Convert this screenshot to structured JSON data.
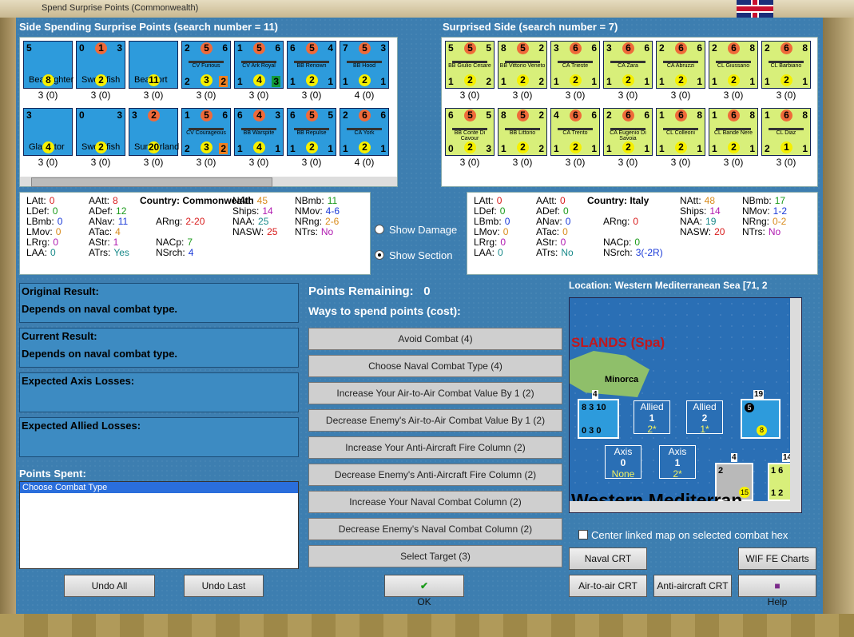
{
  "window_title": "Spend Surprise Points (Commonwealth)",
  "left_header": "Side Spending Surprise Points (search number = 11)",
  "right_header": "Surprised Side (search number = 7)",
  "left_units": [
    {
      "tl": "5",
      "tm": "",
      "tr": "",
      "name": "Beaufighter",
      "bl": "",
      "bm": "8",
      "br": "",
      "cap": "3 (0)",
      "kind": "plane"
    },
    {
      "tl": "0",
      "tm": "1",
      "tr": "3",
      "name": "Swordfish",
      "bl": "",
      "bm": "2",
      "br": "",
      "cap": "3 (0)",
      "kind": "plane"
    },
    {
      "tl": "",
      "tm": "",
      "tr": "",
      "name": "Beaufort",
      "bl": "",
      "bm": "11",
      "br": "",
      "cap": "3 (0)",
      "kind": "plane"
    },
    {
      "tl": "2",
      "tm": "5",
      "tr": "6",
      "name": "CV Furious",
      "bl": "2",
      "bm": "3",
      "br": "2",
      "cap": "3 (0)",
      "kind": "ship",
      "brbox": "orange"
    },
    {
      "tl": "1",
      "tm": "5",
      "tr": "6",
      "name": "CV Ark Royal",
      "bl": "1",
      "bm": "4",
      "br": "3",
      "cap": "3 (0)",
      "kind": "ship",
      "brbox": "green"
    },
    {
      "tl": "6",
      "tm": "5",
      "tr": "4",
      "name": "BB Renown",
      "bl": "1",
      "bm": "2",
      "br": "1",
      "cap": "3 (0)",
      "kind": "ship"
    },
    {
      "tl": "7",
      "tm": "5",
      "tr": "3",
      "name": "BB Hood",
      "bl": "1",
      "bm": "2",
      "br": "1",
      "cap": "4 (0)",
      "kind": "ship"
    },
    {
      "tl": "3",
      "tm": "",
      "tr": "",
      "name": "Gladiator",
      "bl": "",
      "bm": "4",
      "br": "",
      "cap": "3 (0)",
      "kind": "plane"
    },
    {
      "tl": "0",
      "tm": "",
      "tr": "3",
      "name": "Swordfish",
      "bl": "",
      "bm": "2",
      "br": "",
      "cap": "3 (0)",
      "kind": "plane"
    },
    {
      "tl": "3",
      "tm": "2",
      "tr": "",
      "name": "Sunderland",
      "bl": "",
      "bm": "20",
      "br": "",
      "cap": "3 (0)",
      "kind": "plane"
    },
    {
      "tl": "1",
      "tm": "5",
      "tr": "6",
      "name": "CV Courageous",
      "bl": "2",
      "bm": "3",
      "br": "2",
      "cap": "3 (0)",
      "kind": "ship",
      "brbox": "orange"
    },
    {
      "tl": "6",
      "tm": "4",
      "tr": "3",
      "name": "BB Warspite",
      "bl": "1",
      "bm": "4",
      "br": "1",
      "cap": "3 (0)",
      "kind": "ship"
    },
    {
      "tl": "6",
      "tm": "5",
      "tr": "5",
      "name": "BB Repulse",
      "bl": "1",
      "bm": "2",
      "br": "1",
      "cap": "3 (0)",
      "kind": "ship"
    },
    {
      "tl": "2",
      "tm": "6",
      "tr": "6",
      "name": "CA York",
      "bl": "1",
      "bm": "2",
      "br": "1",
      "cap": "4 (0)",
      "kind": "ship"
    }
  ],
  "right_units": [
    {
      "tl": "5",
      "tm": "5",
      "tr": "5",
      "name": "BB Giulio Cesare",
      "bl": "1",
      "bm": "2",
      "br": "2",
      "cap": "3 (0)"
    },
    {
      "tl": "8",
      "tm": "5",
      "tr": "2",
      "name": "BB Vittorio Veneto",
      "bl": "1",
      "bm": "2",
      "br": "2",
      "cap": "3 (0)"
    },
    {
      "tl": "3",
      "tm": "6",
      "tr": "6",
      "name": "CA Trieste",
      "bl": "1",
      "bm": "2",
      "br": "1",
      "cap": "3 (0)"
    },
    {
      "tl": "3",
      "tm": "6",
      "tr": "6",
      "name": "CA Zara",
      "bl": "1",
      "bm": "2",
      "br": "1",
      "cap": "3 (0)"
    },
    {
      "tl": "2",
      "tm": "6",
      "tr": "6",
      "name": "CA Abruzzi",
      "bl": "1",
      "bm": "2",
      "br": "1",
      "cap": "3 (0)"
    },
    {
      "tl": "2",
      "tm": "6",
      "tr": "8",
      "name": "CL Giussano",
      "bl": "1",
      "bm": "2",
      "br": "1",
      "cap": "3 (0)"
    },
    {
      "tl": "2",
      "tm": "6",
      "tr": "8",
      "name": "CL Barbiano",
      "bl": "1",
      "bm": "2",
      "br": "1",
      "cap": "3 (0)"
    },
    {
      "tl": "6",
      "tm": "5",
      "tr": "5",
      "name": "BB Conte Di Cavour",
      "bl": "0",
      "bm": "2",
      "br": "3",
      "cap": "3 (0)"
    },
    {
      "tl": "8",
      "tm": "5",
      "tr": "2",
      "name": "BB Littorio",
      "bl": "1",
      "bm": "2",
      "br": "2",
      "cap": "3 (0)"
    },
    {
      "tl": "4",
      "tm": "6",
      "tr": "6",
      "name": "CA Trento",
      "bl": "1",
      "bm": "2",
      "br": "1",
      "cap": "3 (0)"
    },
    {
      "tl": "2",
      "tm": "6",
      "tr": "6",
      "name": "CA Eugenio Di Savoia",
      "bl": "1",
      "bm": "2",
      "br": "1",
      "cap": "3 (0)"
    },
    {
      "tl": "1",
      "tm": "6",
      "tr": "8",
      "name": "CL Colleoni",
      "bl": "1",
      "bm": "2",
      "br": "1",
      "cap": "3 (0)"
    },
    {
      "tl": "1",
      "tm": "6",
      "tr": "8",
      "name": "CL Bande Nere",
      "bl": "1",
      "bm": "2",
      "br": "1",
      "cap": "3 (0)"
    },
    {
      "tl": "1",
      "tm": "6",
      "tr": "8",
      "name": "CL Diaz",
      "bl": "2",
      "bm": "1",
      "br": "1",
      "cap": "3 (0)"
    }
  ],
  "left_stats": {
    "country_label": "Country: Commonwealth",
    "lines": [
      [
        "LAtt:",
        "0"
      ],
      [
        "LDef:",
        "0"
      ],
      [
        "LBmb:",
        "0"
      ],
      [
        "LMov:",
        "0"
      ],
      [
        "LRrg:",
        "0"
      ],
      [
        "LAA:",
        "0"
      ],
      [
        "AAtt:",
        "8"
      ],
      [
        "ADef:",
        "12"
      ],
      [
        "ANav:",
        "11"
      ],
      [
        "ATac:",
        "4"
      ],
      [
        "AStr:",
        "1"
      ],
      [
        "ATrs:",
        "Yes"
      ],
      [
        "ARng:",
        "2-20"
      ],
      [
        "NACp:",
        "7"
      ],
      [
        "NSrch:",
        "4"
      ],
      [
        "NAtt:",
        "45"
      ],
      [
        "Ships:",
        "14"
      ],
      [
        "NAA:",
        "25"
      ],
      [
        "NASW:",
        "25"
      ],
      [
        "NBmb:",
        "11"
      ],
      [
        "NMov:",
        "4-6"
      ],
      [
        "NRng:",
        "2-6"
      ],
      [
        "NTrs:",
        "No"
      ]
    ]
  },
  "right_stats": {
    "country_label": "Country: Italy",
    "lines": [
      [
        "LAtt:",
        "0"
      ],
      [
        "LDef:",
        "0"
      ],
      [
        "LBmb:",
        "0"
      ],
      [
        "LMov:",
        "0"
      ],
      [
        "LRrg:",
        "0"
      ],
      [
        "LAA:",
        "0"
      ],
      [
        "AAtt:",
        "0"
      ],
      [
        "ADef:",
        "0"
      ],
      [
        "ANav:",
        "0"
      ],
      [
        "ATac:",
        "0"
      ],
      [
        "AStr:",
        "0"
      ],
      [
        "ATrs:",
        "No"
      ],
      [
        "ARng:",
        "0"
      ],
      [
        "NACp:",
        "0"
      ],
      [
        "NSrch:",
        "3(-2R)"
      ],
      [
        "NAtt:",
        "48"
      ],
      [
        "Ships:",
        "14"
      ],
      [
        "NAA:",
        "19"
      ],
      [
        "NASW:",
        "20"
      ],
      [
        "NBmb:",
        "17"
      ],
      [
        "NMov:",
        "1-2"
      ],
      [
        "NRng:",
        "0-2"
      ],
      [
        "NTrs:",
        "No"
      ]
    ]
  },
  "radios": {
    "show_damage": "Show Damage",
    "show_section": "Show Section"
  },
  "results": [
    {
      "label": "Original Result:",
      "value": "Depends on naval combat type."
    },
    {
      "label": "Current Result:",
      "value": "Depends on naval combat type."
    },
    {
      "label": "Expected Axis Losses:",
      "value": ""
    },
    {
      "label": "Expected Allied Losses:",
      "value": ""
    }
  ],
  "points_spent_label": "Points Spent:",
  "points_spent_items": [
    "Choose Combat Type"
  ],
  "points_remaining_label": "Points Remaining:",
  "points_remaining_value": "0",
  "ways_label": "Ways to spend points (cost):",
  "ways": [
    "Avoid Combat (4)",
    "Choose Naval Combat Type (4)",
    "Increase Your Air-to-Air Combat Value By 1 (2)",
    "Decrease Enemy's Air-to-Air Combat Value By 1 (2)",
    "Increase Your Anti-Aircraft Fire Column (2)",
    "Decrease Enemy's Anti-Aircraft Fire Column (2)",
    "Increase Your Naval Combat Column (2)",
    "Decrease Enemy's Naval Combat Column (2)",
    "Select Target (3)"
  ],
  "location_label": "Location: Western Mediterranean Sea [71, 2",
  "map": {
    "islands_label": "SLANDS (Spa)",
    "minorca_label": "Minorca",
    "sea_label": "Western Mediterran",
    "allied1": {
      "label": "Allied",
      "num": "1",
      "sub": "2*"
    },
    "allied2": {
      "label": "Allied",
      "num": "2",
      "sub": "1*"
    },
    "axis0": {
      "label": "Axis",
      "num": "0",
      "sub": "None"
    },
    "axis1": {
      "label": "Axis",
      "num": "1",
      "sub": "2*"
    },
    "stack_counts": [
      "4",
      "19",
      "4",
      "14"
    ]
  },
  "center_linked_label": "Center linked map on selected combat hex",
  "buttons": {
    "undo_all": "Undo All",
    "undo_last": "Undo Last",
    "ok": "OK",
    "naval_crt": "Naval CRT",
    "wif_charts": "WIF FE Charts",
    "air_crt": "Air-to-air CRT",
    "aa_crt": "Anti-aircraft CRT",
    "help": "Help"
  },
  "colors": {
    "panel_blue": "#3d7eb0",
    "allied_counter": "#2d9bdc",
    "italy_counter": "#d8ef7a"
  }
}
